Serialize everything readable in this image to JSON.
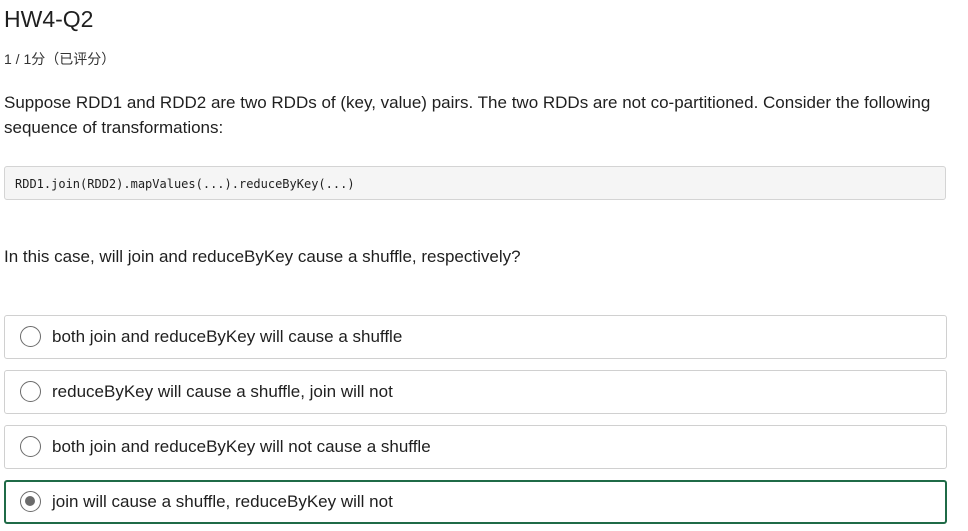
{
  "header": {
    "title": "HW4-Q2",
    "score": "1 / 1分（已评分）"
  },
  "question": {
    "text": "Suppose RDD1 and RDD2 are two RDDs of (key, value) pairs. The two RDDs are not co-partitioned. Consider the following sequence of transformations:",
    "code": "RDD1.join(RDD2).mapValues(...).reduceByKey(...)",
    "prompt": "In this case, will join and reduceByKey cause a shuffle, respectively?"
  },
  "options": [
    {
      "label": "both join and reduceByKey will cause a shuffle",
      "selected": false
    },
    {
      "label": "reduceByKey will cause a shuffle, join will not",
      "selected": false
    },
    {
      "label": "both join and reduceByKey will not cause a shuffle",
      "selected": false
    },
    {
      "label": "join will cause a shuffle, reduceByKey will not",
      "selected": true
    }
  ],
  "colors": {
    "selected_border": "#1f6b47",
    "radio": "#6b6b6b",
    "code_background": "#f5f5f5"
  }
}
